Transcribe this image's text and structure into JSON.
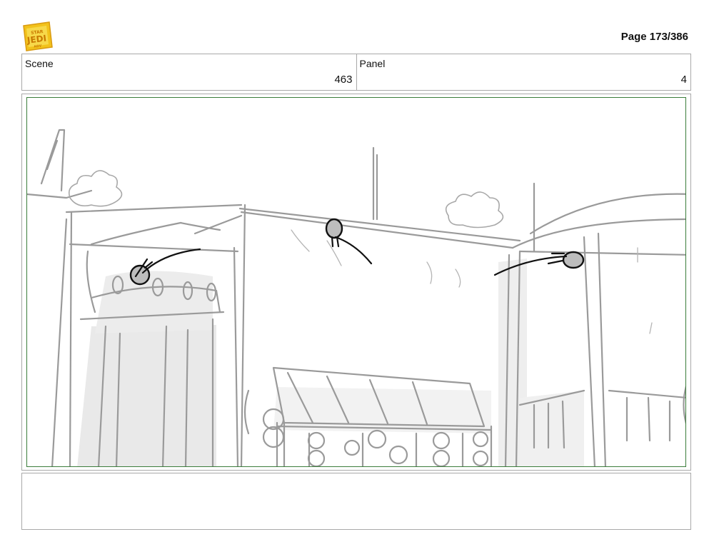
{
  "header": {
    "page_label": "Page 173/386",
    "logo_icon": "young-jedi-adventures-logo",
    "logo_colors": {
      "primary": "#f2c21b",
      "secondary": "#e8a20e"
    }
  },
  "info": {
    "scene_label": "Scene",
    "scene_value": "463",
    "panel_label": "Panel",
    "panel_value": "4"
  },
  "panel": {
    "sketch_description_icon": "storyboard-sketch",
    "frame_color": "#3b7d3b"
  },
  "notes": {
    "text": ""
  }
}
